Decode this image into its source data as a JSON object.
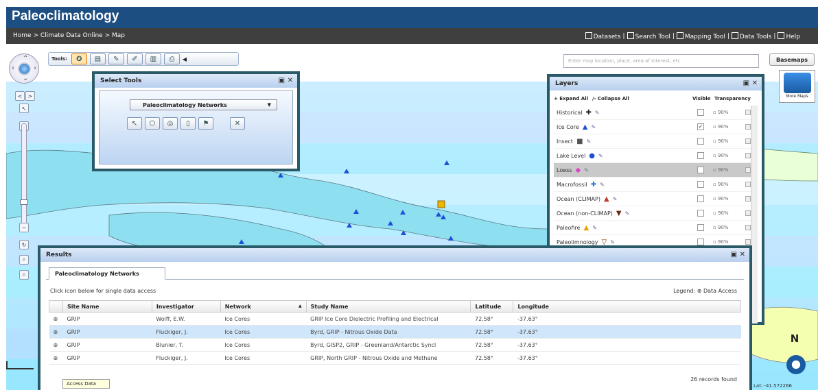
{
  "banner": {
    "title": "Paleoclimatology"
  },
  "nav": {
    "breadcrumb": "Home > Climate Data Online > Map",
    "links": [
      {
        "label": "Datasets",
        "icon": "datasets-icon"
      },
      {
        "label": "Search Tool",
        "icon": "search-tool-icon"
      },
      {
        "label": "Mapping Tool",
        "icon": "mapping-tool-icon"
      },
      {
        "label": "Data Tools",
        "icon": "data-tools-icon"
      },
      {
        "label": "Help",
        "icon": "help-icon"
      }
    ],
    "separator": "|"
  },
  "toolbar": {
    "label": "Tools:"
  },
  "search": {
    "placeholder": "Enter map location, place, area of interest, etc."
  },
  "basemaps": {
    "label": "Basemaps",
    "more_label": "More Maps"
  },
  "select_tools": {
    "title": "Select Tools",
    "dropdown_value": "Paleoclimatology Networks",
    "clear_label": "✕"
  },
  "layers": {
    "title": "Layers",
    "expand_all": "+ Expand All",
    "collapse_all": "/- Collapse All",
    "visible_header": "Visible",
    "transparency_header": "Transparency",
    "items": [
      {
        "name": "Historical",
        "symbol": "✚",
        "color": "#222222",
        "visible": false,
        "transparency": "90%",
        "selected": false
      },
      {
        "name": "Ice Core",
        "symbol": "▲",
        "color": "#1f4fd6",
        "visible": true,
        "transparency": "90%",
        "selected": false
      },
      {
        "name": "Insect",
        "symbol": "■",
        "color": "#555555",
        "visible": false,
        "transparency": "90%",
        "selected": false
      },
      {
        "name": "Lake Level",
        "symbol": "●",
        "color": "#1f4fd6",
        "visible": false,
        "transparency": "90%",
        "selected": false
      },
      {
        "name": "Loess",
        "symbol": "◆",
        "color": "#e040c8",
        "visible": false,
        "transparency": "90%",
        "selected": true
      },
      {
        "name": "Macrofossil",
        "symbol": "✚",
        "color": "#1f6fe6",
        "visible": false,
        "transparency": "90%",
        "selected": false
      },
      {
        "name": "Ocean (CLIMAP)",
        "symbol": "▲",
        "color": "#c0392b",
        "visible": false,
        "transparency": "90%",
        "selected": false
      },
      {
        "name": "Ocean (non-CLIMAP)",
        "symbol": "▼",
        "color": "#6b2a12",
        "visible": false,
        "transparency": "90%",
        "selected": false
      },
      {
        "name": "Paleofire",
        "symbol": "▲",
        "color": "#e6a400",
        "visible": false,
        "transparency": "90%",
        "selected": false
      },
      {
        "name": "Paleolimnology",
        "symbol": "▽",
        "color": "#7a3a12",
        "visible": false,
        "transparency": "90%",
        "selected": false
      }
    ]
  },
  "results": {
    "title": "Results",
    "tab": "Paleoclimatology Networks",
    "hint": "Click icon below for single data access",
    "legend": "Legend: ⊕ Data Access",
    "columns": [
      "",
      "Site Name",
      "Investigator",
      "Network",
      "Study Name",
      "Latitude",
      "Longitude"
    ],
    "sort_indicator": "▲",
    "rows": [
      {
        "icon": "⊕",
        "site": "GRIP",
        "investigator": "Wolff, E.W.",
        "network": "Ice Cores",
        "study": "GRIP Ice Core Dielectric Profiling and Electrical",
        "lat": "72.58°",
        "lon": "-37.63°",
        "highlight": false
      },
      {
        "icon": "⊕",
        "site": "GRIP",
        "investigator": "Fluckiger, J.",
        "network": "Ice Cores",
        "study": "Byrd, GRIP - Nitrous Oxide Data",
        "lat": "72.58°",
        "lon": "-37.63°",
        "highlight": true
      },
      {
        "icon": "⊕",
        "site": "GRIP",
        "investigator": "Blunier, T.",
        "network": "Ice Cores",
        "study": "Byrd, GISP2, GRIP - Greenland/Antarctic Syncl",
        "lat": "72.58°",
        "lon": "-37.63°",
        "highlight": false
      },
      {
        "icon": "⊕",
        "site": "GRIP",
        "investigator": "Fluckiger, J.",
        "network": "Ice Cores",
        "study": "GRIP, North GRIP - Nitrous Oxide and Methane",
        "lat": "72.58°",
        "lon": "-37.63°",
        "highlight": false
      }
    ],
    "count": "26 records found"
  },
  "tooltip": "Access Data",
  "coords": "Lat: -41.572266",
  "north_label": "N"
}
